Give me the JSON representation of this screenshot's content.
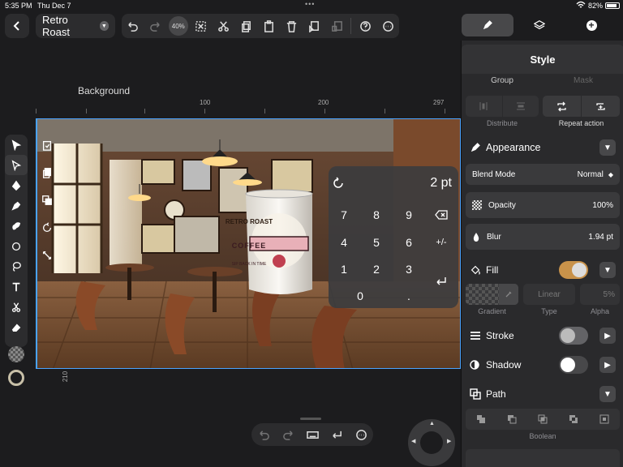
{
  "status": {
    "time": "5:35 PM",
    "date": "Thu Dec 7",
    "battery": "82%"
  },
  "header": {
    "doc_title": "Retro Roast",
    "zoom": "40%"
  },
  "canvas": {
    "artboard_label": "Background",
    "ruler_h": [
      "100",
      "200",
      "297"
    ],
    "ruler_v": [
      "100",
      "210"
    ],
    "mug_text_top": "RETRO ROAST",
    "mug_text_banner": "COFFEE",
    "mug_text_bottom": "SIP BACK IN TIME"
  },
  "numpad": {
    "value": "2 pt",
    "keys": [
      "7",
      "8",
      "9",
      "4",
      "5",
      "6",
      "1",
      "2",
      "3",
      "0",
      "."
    ],
    "plusminus": "+/-"
  },
  "panel": {
    "tab_style": "Style",
    "group_label": "Group",
    "mask_label": "Mask",
    "distribute_label": "Distribute",
    "repeat_label": "Repeat action",
    "appearance": {
      "title": "Appearance",
      "blend_label": "Blend Mode",
      "blend_value": "Normal",
      "opacity_label": "Opacity",
      "opacity_value": "100%",
      "blur_label": "Blur",
      "blur_value": "1.94 pt"
    },
    "fill": {
      "title": "Fill",
      "on": true,
      "gradient_label": "Gradient",
      "type_label": "Type",
      "type_value": "Linear",
      "alpha_label": "Alpha",
      "alpha_value": "5%"
    },
    "stroke": {
      "title": "Stroke",
      "on": false
    },
    "shadow": {
      "title": "Shadow",
      "on": false
    },
    "path": {
      "title": "Path",
      "boolean_label": "Boolean"
    }
  },
  "colors": {
    "accent": "#4aa3ff",
    "fill_toggle": "#c8924a",
    "panel_bg": "#2a2a2c"
  }
}
